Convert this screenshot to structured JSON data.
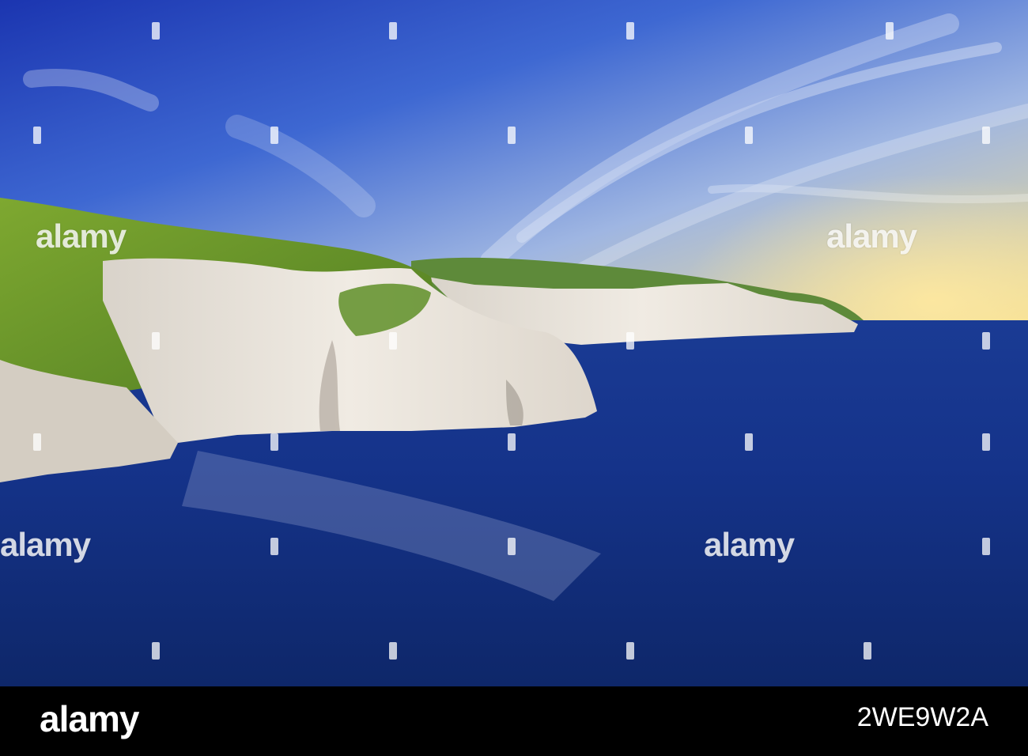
{
  "photo": {
    "description_colors": {
      "sky_top": "#1d3fb8",
      "sky_horizon": "#e8d690",
      "sea": "#13307f",
      "cliff": "#e9e4dc",
      "vegetation": "#6f9a2a"
    },
    "watermark_text": "alamy"
  },
  "bottom_bar": {
    "logo": "alamy",
    "image_id": "2WE9W2A"
  }
}
